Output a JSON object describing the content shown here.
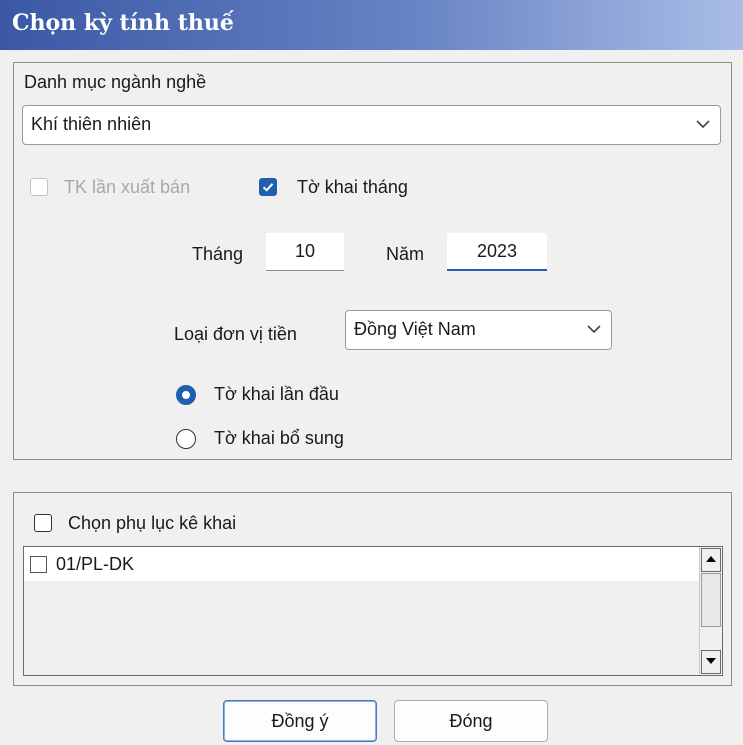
{
  "window": {
    "title": "Chọn kỳ tính thuế"
  },
  "industry": {
    "label": "Danh mục ngành nghề",
    "selected": "Khí thiên nhiên"
  },
  "options": {
    "export_label": "TK lần xuất bán",
    "export_checked": false,
    "export_enabled": false,
    "monthly_label": "Tờ khai tháng",
    "monthly_checked": true
  },
  "period": {
    "month_label": "Tháng",
    "month_value": "10",
    "year_label": "Năm",
    "year_value": "2023"
  },
  "currency": {
    "label": "Loại đơn vị tiền",
    "selected": "Đồng Việt Nam"
  },
  "declaration_type": {
    "first_label": "Tờ khai lần đầu",
    "supplement_label": "Tờ khai bổ sung",
    "selected": "first"
  },
  "appendix": {
    "header_label": "Chọn phụ lục kê khai",
    "items": [
      {
        "label": "01/PL-DK",
        "checked": false
      }
    ]
  },
  "buttons": {
    "ok_label": "Đồng ý",
    "close_label": "Đóng"
  },
  "colors": {
    "accent": "#1f5fb0",
    "title_bar": "#3b58a5"
  }
}
